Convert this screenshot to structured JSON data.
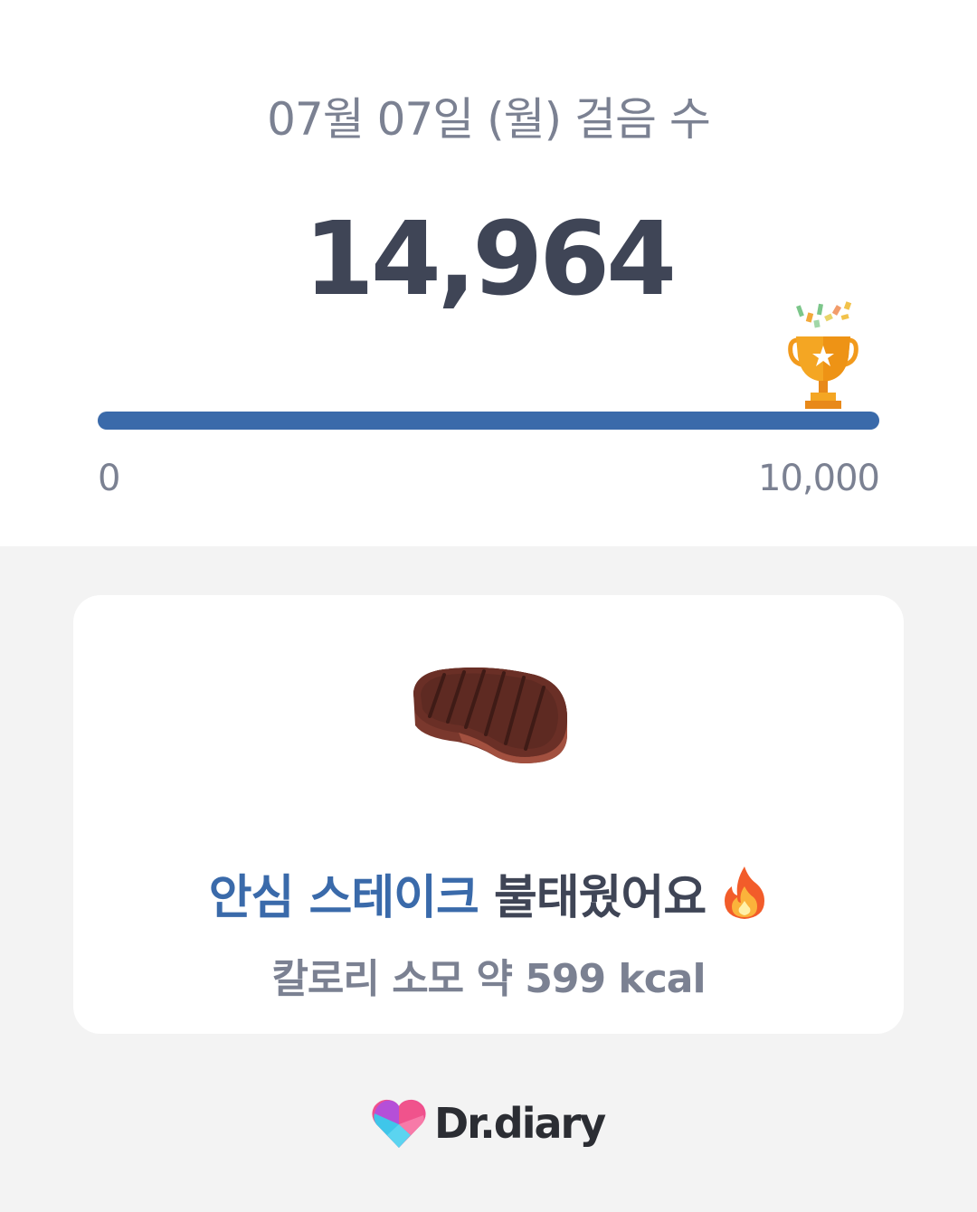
{
  "header": {
    "title": "07월 07일 (월) 걸음 수",
    "step_count": "14,964"
  },
  "progress": {
    "min_label": "0",
    "max_label": "10,000",
    "value": 14964,
    "goal": 10000,
    "fill_fraction": 1.0,
    "color": "#3a6aaa",
    "goal_icon": "trophy-icon"
  },
  "calorie_card": {
    "food_icon": "steak-icon",
    "food_name": "안심 스테이크",
    "burned_text": "불태웠어요",
    "fire_icon": "fire-icon",
    "calorie_text": "칼로리 소모 약 599 kcal"
  },
  "brand": {
    "name": "Dr.diary",
    "logo_icon": "heart-logo-icon"
  },
  "colors": {
    "accent": "#3a6aaa",
    "text_dark": "#3f4556",
    "text_muted": "#7b8192",
    "background": "#f3f3f3"
  }
}
